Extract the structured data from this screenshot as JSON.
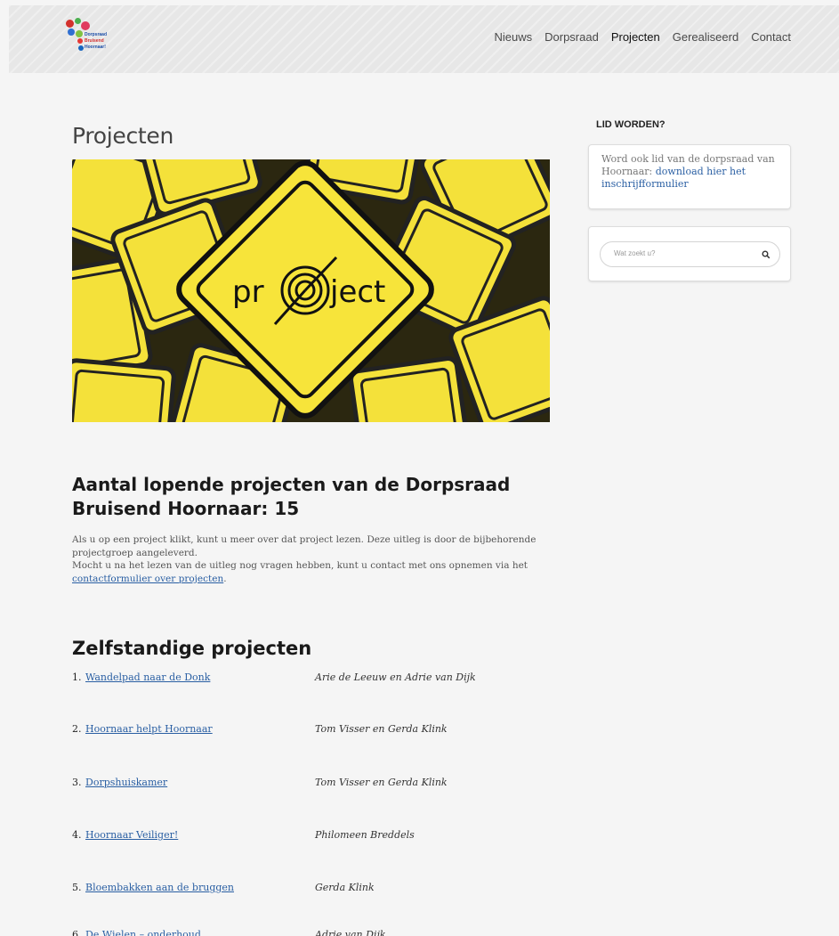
{
  "header": {
    "logo": {
      "line1": "Dorpsraad",
      "line2": "Bruisend",
      "line3": "Hoornaar!"
    },
    "nav": [
      "Nieuws",
      "Dorpsraad",
      "Projecten",
      "Gerealiseerd",
      "Contact"
    ],
    "active_nav": "Projecten"
  },
  "main": {
    "title": "Projecten",
    "hero_image": {
      "words": [
        "pr",
        "ject"
      ]
    },
    "count_heading": "Aantal lopende projecten van de Dorpsraad Bruisend Hoornaar: 15",
    "intro_line1": "Als u op een project klikt, kunt u meer over dat project lezen. Deze uitleg is door de bijbehorende projectgroep aangeleverd.",
    "intro_line2": "Mocht u na het lezen van de uitleg nog vragen hebben, kunt u contact met ons opnemen via het",
    "intro_link": "contactformulier over projecten",
    "intro_end": ".",
    "zelf_heading": "Zelfstandige projecten",
    "projects": [
      {
        "num": "1.",
        "name": "Wandelpad naar de Donk",
        "owner": "Arie de Leeuw en Adrie van Dijk"
      },
      {
        "num": "2.",
        "name": "Hoornaar helpt Hoornaar",
        "owner": "Tom Visser en Gerda Klink"
      },
      {
        "num": "3.",
        "name": "Dorpshuiskamer",
        "owner": "Tom Visser en Gerda Klink"
      },
      {
        "num": "4.",
        "name": "Hoornaar Veiliger!",
        "owner": "Philomeen Breddels"
      },
      {
        "num": "5.",
        "name": "Bloembakken aan de bruggen",
        "owner": "Gerda Klink"
      },
      {
        "num": "6.",
        "name": "De Wielen – onderhoud",
        "owner": "Adrie van Dijk"
      }
    ]
  },
  "sidebar": {
    "member_title": "LID WORDEN?",
    "member_text": "Word ook lid van de dorpsraad van Hoornaar:",
    "member_link": "download hier het inschrijfformulier",
    "search_placeholder": "Wat zoekt u?"
  },
  "colors": {
    "link": "#2a5fa3",
    "background": "#f5f5f5",
    "hero_yellow": "#f4e13a"
  }
}
